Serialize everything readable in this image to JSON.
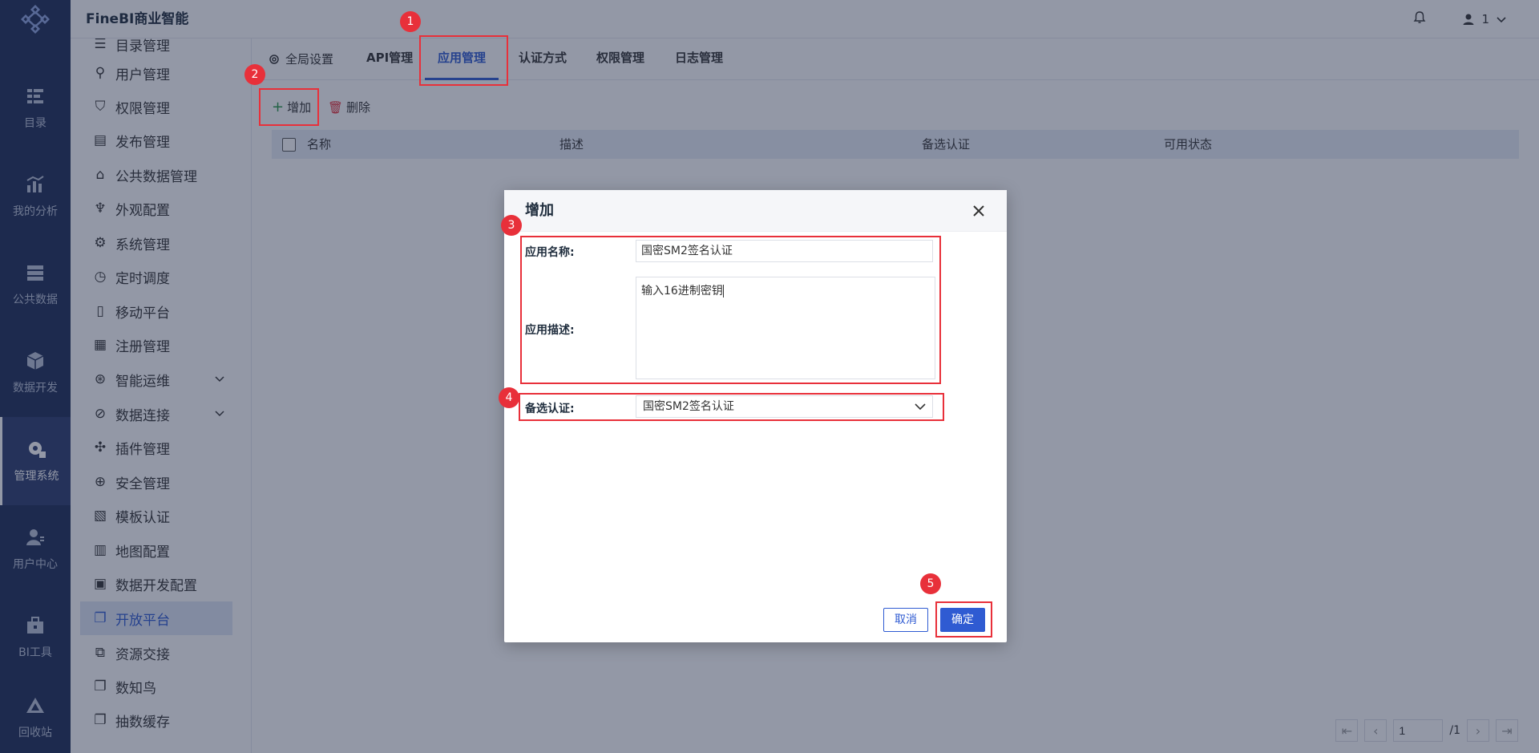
{
  "app": {
    "title": "FineBI商业智能"
  },
  "topbar": {
    "user_label": "1"
  },
  "rail": [
    {
      "label": "目录",
      "icon": "catalog-icon"
    },
    {
      "label": "我的分析",
      "icon": "analysis-icon"
    },
    {
      "label": "公共数据",
      "icon": "public-data-icon"
    },
    {
      "label": "数据开发",
      "icon": "data-dev-icon"
    },
    {
      "label": "管理系统",
      "icon": "management-icon",
      "active": true
    },
    {
      "label": "用户中心",
      "icon": "user-center-icon"
    },
    {
      "label": "BI工具",
      "icon": "toolbox-icon"
    },
    {
      "label": "回收站",
      "icon": "recycle-icon"
    }
  ],
  "sidebar": {
    "items": [
      {
        "label": "目录管理"
      },
      {
        "label": "用户管理"
      },
      {
        "label": "权限管理"
      },
      {
        "label": "发布管理"
      },
      {
        "label": "公共数据管理"
      },
      {
        "label": "外观配置"
      },
      {
        "label": "系统管理"
      },
      {
        "label": "定时调度"
      },
      {
        "label": "移动平台"
      },
      {
        "label": "注册管理"
      },
      {
        "label": "智能运维",
        "expandable": true
      },
      {
        "label": "数据连接",
        "expandable": true
      },
      {
        "label": "插件管理"
      },
      {
        "label": "安全管理"
      },
      {
        "label": "模板认证"
      },
      {
        "label": "地图配置"
      },
      {
        "label": "数据开发配置"
      },
      {
        "label": "开放平台",
        "active": true
      },
      {
        "label": "资源交接"
      },
      {
        "label": "数知鸟"
      },
      {
        "label": "抽数缓存"
      }
    ]
  },
  "tabs": [
    {
      "label": "全局设置"
    },
    {
      "label": "API管理"
    },
    {
      "label": "应用管理",
      "active": true
    },
    {
      "label": "认证方式"
    },
    {
      "label": "权限管理"
    },
    {
      "label": "日志管理"
    }
  ],
  "toolbar": {
    "add_label": "增加",
    "delete_label": "删除"
  },
  "table": {
    "columns": [
      "名称",
      "描述",
      "备选认证",
      "可用状态"
    ]
  },
  "pager": {
    "page": "1",
    "total": "/1"
  },
  "dialog": {
    "title": "增加",
    "name_label": "应用名称:",
    "name_value": "国密SM2签名认证",
    "desc_label": "应用描述:",
    "desc_value": "输入16进制密钥",
    "auth_label": "备选认证:",
    "auth_value": "国密SM2签名认证",
    "cancel_label": "取消",
    "ok_label": "确定"
  },
  "annotations": [
    "1",
    "2",
    "3",
    "4",
    "5"
  ],
  "colors": {
    "accent": "#2f5bd2",
    "rail_bg": "#1e2d56",
    "annotation_red": "#e8303a"
  }
}
